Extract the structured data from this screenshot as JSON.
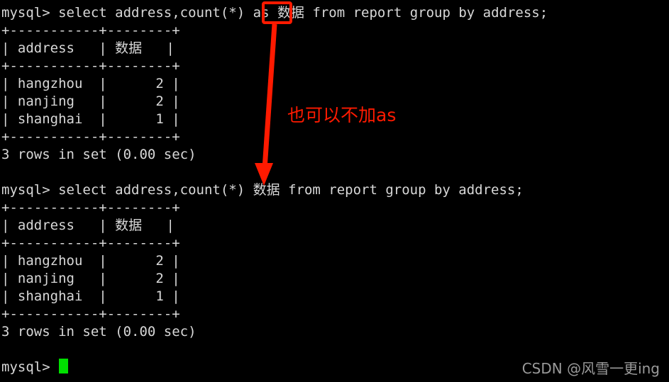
{
  "terminal": {
    "background_color": "#000000",
    "text_color": "#d8d8d8",
    "lines": [
      "mysql> select address,count(*) as 数据 from report group by address;",
      "+-----------+--------+",
      "| address   | 数据   |",
      "+-----------+--------+",
      "| hangzhou  |      2 |",
      "| nanjing   |      2 |",
      "| shanghai  |      1 |",
      "+-----------+--------+",
      "3 rows in set (0.00 sec)",
      "",
      "mysql> select address,count(*) 数据 from report group by address;",
      "+-----------+--------+",
      "| address   | 数据   |",
      "+-----------+--------+",
      "| hangzhou  |      2 |",
      "| nanjing   |      2 |",
      "| shanghai  |      1 |",
      "+-----------+--------+",
      "3 rows in set (0.00 sec)",
      "",
      "mysql> "
    ],
    "query_1": {
      "prompt": "mysql> ",
      "before_keyword": "select address,count(*) ",
      "keyword": "as",
      "alias": "数据",
      "after_alias": " from report group by address;"
    },
    "query_2": {
      "prompt": "mysql> ",
      "statement_head": "select address,count(*) ",
      "alias": "数据",
      "statement_tail": " from report group by address;"
    },
    "result_table": {
      "separator": "+-----------+--------+",
      "header_row": "| address   | 数据   |",
      "headers": [
        "address",
        "数据"
      ],
      "rows": [
        {
          "line": "| hangzhou  |      2 |",
          "address": "hangzhou",
          "count": "2"
        },
        {
          "line": "| nanjing   |      2 |",
          "address": "nanjing",
          "count": "2"
        },
        {
          "line": "| shanghai  |      1 |",
          "address": "shanghai",
          "count": "1"
        }
      ],
      "status": "3 rows in set (0.00 sec)"
    },
    "final_prompt": "mysql> ",
    "cursor": {
      "color": "#00e000",
      "visible": true
    }
  },
  "annotation": {
    "text": "也可以不加as",
    "color": "#ff1a00",
    "highlight_box": {
      "target": "as",
      "color": "#ff1a00"
    },
    "arrow": {
      "color": "#ff1a00",
      "direction": "down"
    }
  },
  "watermark": {
    "text": "CSDN @风雪一更ing",
    "color": "#9a9a9a"
  }
}
